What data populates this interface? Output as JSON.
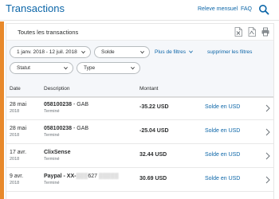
{
  "header": {
    "title": "Transactions",
    "releve_link": "Releve mensuel",
    "faq_link": "FAQ",
    "search_icon": "search-icon"
  },
  "colors": {
    "accent": "#e8892b",
    "link": "#0c66a8",
    "text": "#2c2e2f",
    "muted": "#6c7378",
    "filter_background": "#f5f7fa"
  },
  "panel": {
    "title": "Toutes les transactions",
    "icons": [
      "excel-icon",
      "pdf-icon",
      "print-icon"
    ]
  },
  "filters": {
    "date_range": "1 janv. 2018 - 12 juil. 2018",
    "currency": "Solde",
    "more_filters": "Plus de filtres",
    "remove_filters": "supprimer les filtres",
    "statut": "Statut",
    "type": "Type"
  },
  "table": {
    "columns": {
      "date": "Date",
      "description": "Description",
      "amount": "Montant"
    },
    "rows": [
      {
        "day": "28 mai",
        "year": "2018",
        "name": "058100238",
        "name_suffix": " - GAB",
        "status": "Terminé",
        "amount": "-35.22 USD",
        "balance": "Solde en USD"
      },
      {
        "day": "28 mai",
        "year": "2018",
        "name": "058100238",
        "name_suffix": " - GAB",
        "status": "Terminé",
        "amount": "-25.04 USD",
        "balance": "Solde en USD"
      },
      {
        "day": "17 avr.",
        "year": "2018",
        "name": "ClixSense",
        "name_suffix": "",
        "status": "Terminé",
        "amount": "32.44 USD",
        "balance": "Solde en USD"
      },
      {
        "day": "9 avr.",
        "year": "2018",
        "name": "Paypal - XX-",
        "name_suffix": "627",
        "status": "Terminé",
        "amount": "30.69 USD",
        "balance": "Solde en USD"
      }
    ]
  }
}
